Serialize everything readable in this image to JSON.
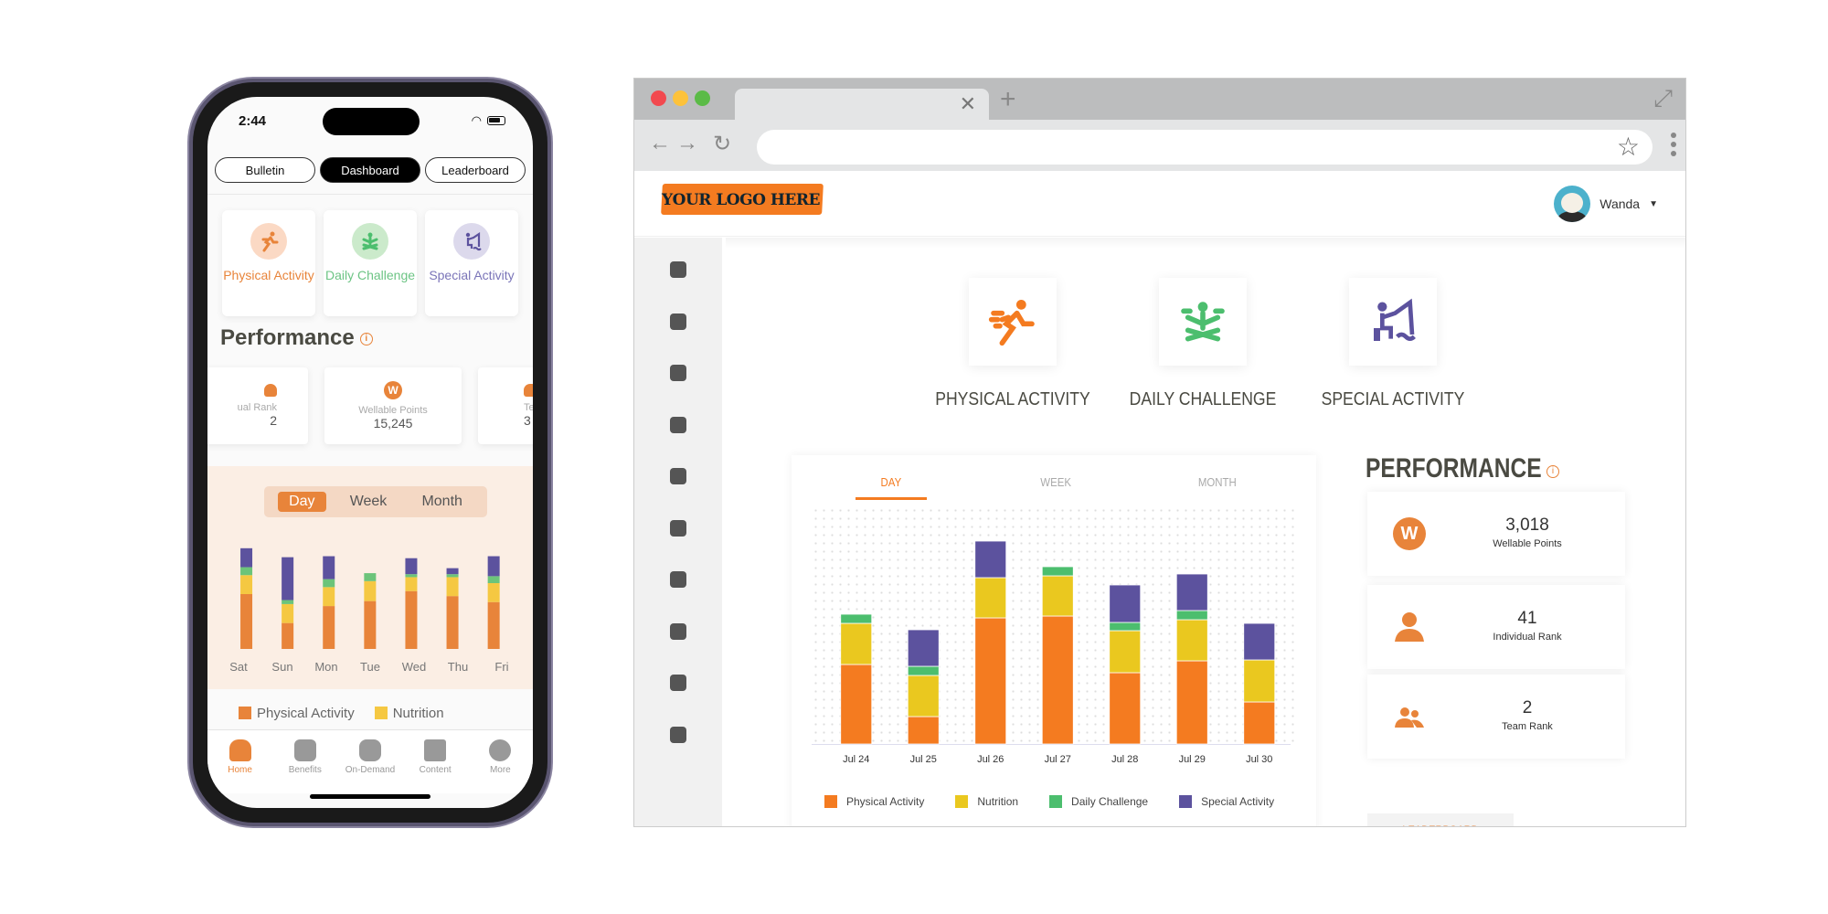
{
  "colors": {
    "physical": "#f47b20",
    "nutrition": "#eac81f",
    "daily": "#4cbe6e",
    "special": "#5c529e",
    "accent": "#e8843a"
  },
  "phone": {
    "time": "2:44",
    "segments": [
      {
        "label": "Bulletin",
        "active": false
      },
      {
        "label": "Dashboard",
        "active": true
      },
      {
        "label": "Leaderboard",
        "active": false
      }
    ],
    "categories": [
      {
        "label": "Physical Activity",
        "icon": "running-icon"
      },
      {
        "label": "Daily Challenge",
        "icon": "meditation-icon"
      },
      {
        "label": "Special Activity",
        "icon": "fishing-icon"
      }
    ],
    "performance_title": "Performance",
    "stats": [
      {
        "label": "Individual Rank",
        "value": "2",
        "visible_label": "ual Rank"
      },
      {
        "label": "Wellable Points",
        "value": "15,245"
      },
      {
        "label": "Team Rank",
        "value": "3",
        "visible_label": "Team"
      }
    ],
    "toggle": [
      "Day",
      "Week",
      "Month"
    ],
    "toggle_active": "Day",
    "legend": [
      "Physical Activity",
      "Nutrition"
    ],
    "tabbar": [
      {
        "label": "Home",
        "icon": "home-icon",
        "active": true
      },
      {
        "label": "Benefits",
        "icon": "gift-icon",
        "active": false
      },
      {
        "label": "On-Demand",
        "icon": "play-icon",
        "active": false
      },
      {
        "label": "Content",
        "icon": "content-icon",
        "active": false
      },
      {
        "label": "More",
        "icon": "more-icon",
        "active": false
      }
    ]
  },
  "browser": {
    "user_name": "Wanda",
    "logo_text": "YOUR LOGO HERE",
    "sidebar_icons": [
      "megaphone-icon",
      "gift-icon",
      "grid-icon",
      "bar-chart-icon",
      "content-list-icon",
      "user-icon",
      "play-icon",
      "chat-icon",
      "link-icon",
      "watch-icon"
    ],
    "categories": [
      {
        "label": "PHYSICAL ACTIVITY",
        "icon": "running-icon"
      },
      {
        "label": "DAILY CHALLENGE",
        "icon": "meditation-icon"
      },
      {
        "label": "SPECIAL ACTIVITY",
        "icon": "fishing-icon"
      }
    ],
    "chart_tabs": [
      "DAY",
      "WEEK",
      "MONTH"
    ],
    "chart_tab_active": "DAY",
    "performance_title": "PERFORMANCE",
    "stats": [
      {
        "value": "3,018",
        "label": "Wellable Points",
        "icon": "wellable-points-icon"
      },
      {
        "value": "41",
        "label": "Individual Rank",
        "icon": "user-icon"
      },
      {
        "value": "2",
        "label": "Team Rank",
        "icon": "team-icon"
      }
    ],
    "leaderboard_button": "LEADERBOARD"
  },
  "chart_data": [
    {
      "type": "bar",
      "stacked": true,
      "title": "",
      "categories": [
        "Jul 24",
        "Jul 25",
        "Jul 26",
        "Jul 27",
        "Jul 28",
        "Jul 29",
        "Jul 30"
      ],
      "series": [
        {
          "name": "Physical Activity",
          "values": [
            87,
            30,
            138,
            140,
            78,
            91,
            46
          ]
        },
        {
          "name": "Nutrition",
          "values": [
            45,
            45,
            44,
            44,
            46,
            45,
            46
          ]
        },
        {
          "name": "Daily Challenge",
          "values": [
            10,
            10,
            0,
            10,
            9,
            10,
            0
          ]
        },
        {
          "name": "Special Activity",
          "values": [
            0,
            40,
            40,
            0,
            41,
            40,
            40
          ]
        }
      ],
      "ylim": [
        0,
        250
      ],
      "grid": true,
      "legend": "bottom",
      "xlabel": "",
      "ylabel": ""
    },
    {
      "type": "bar",
      "stacked": true,
      "title": "",
      "categories": [
        "Sat",
        "Sun",
        "Mon",
        "Tue",
        "Wed",
        "Thu",
        "Fri"
      ],
      "series": [
        {
          "name": "Physical Activity",
          "values": [
            55,
            26,
            43,
            48,
            58,
            53,
            47
          ]
        },
        {
          "name": "Nutrition",
          "values": [
            19,
            19,
            19,
            20,
            14,
            19,
            19
          ]
        },
        {
          "name": "Daily Challenge",
          "values": [
            8,
            4,
            8,
            8,
            3,
            3,
            7
          ]
        },
        {
          "name": "Special Activity",
          "values": [
            19,
            43,
            23,
            0,
            16,
            6,
            20
          ]
        }
      ],
      "ylim": [
        0,
        110
      ],
      "legend": "bottom"
    }
  ]
}
